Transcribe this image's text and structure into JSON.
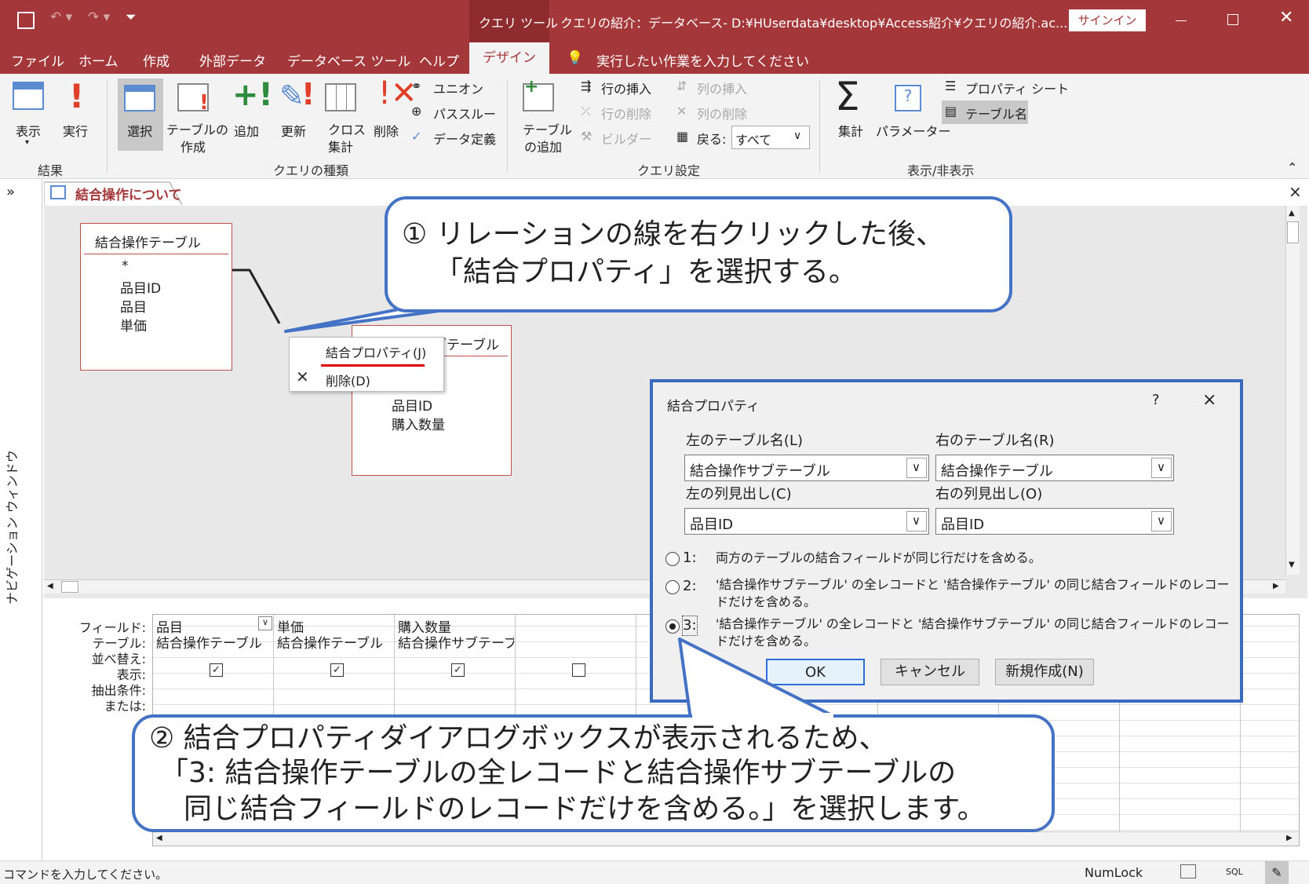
{
  "title_bar": {
    "context_tool_label": "クエリ ツール",
    "title": "クエリの紹介：データベース- D:¥HUserdata¥desktop¥Access紹介¥クエリの紹介.ac...",
    "signin": "サインイン"
  },
  "menu": {
    "tabs": [
      "ファイル",
      "ホーム",
      "作成",
      "外部データ",
      "データベース ツール",
      "ヘルプ"
    ],
    "active_tab": "デザイン",
    "tell_me": "実行したい作業を入力してください"
  },
  "ribbon": {
    "results": {
      "view": "表示",
      "run": "実行",
      "group": "結果"
    },
    "query_type": {
      "select": "選択",
      "make_table_1": "テーブルの",
      "make_table_2": "作成",
      "append": "追加",
      "update": "更新",
      "crosstab_1": "クロス",
      "crosstab_2": "集計",
      "delete": "削除",
      "union": "ユニオン",
      "passthrough": "パススルー",
      "data_definition": "データ定義",
      "group": "クエリの種類"
    },
    "query_setup": {
      "add_table_1": "テーブル",
      "add_table_2": "の追加",
      "insert_rows": "行の挿入",
      "delete_rows": "行の削除",
      "builder": "ビルダー",
      "insert_columns": "列の挿入",
      "delete_columns": "列の削除",
      "return_label": "戻る:",
      "return_value": "すべて",
      "group": "クエリ設定"
    },
    "show_hide": {
      "totals": "集計",
      "parameters": "パラメーター",
      "property_sheet": "プロパティ シート",
      "table_names": "テーブル名",
      "group": "表示/非表示"
    }
  },
  "nav_pane": {
    "label": "ナビゲーション ウィンドウ",
    "expand": "»"
  },
  "document": {
    "tab_title": "結合操作について",
    "close": "×"
  },
  "tables": {
    "left": {
      "name": "結合操作テーブル",
      "fields": [
        "*",
        "品目ID",
        "品目",
        "単価"
      ]
    },
    "right": {
      "name": "結合操作サブテーブル",
      "fields": [
        "品目ID",
        "購入数量"
      ]
    }
  },
  "context_menu": {
    "join_properties": "結合プロパティ(J)",
    "delete": "削除(D)"
  },
  "dialog": {
    "title": "結合プロパティ",
    "help": "?",
    "close": "×",
    "left_table_label": "左のテーブル名(L)",
    "left_table_value": "結合操作サブテーブル",
    "right_table_label": "右のテーブル名(R)",
    "right_table_value": "結合操作テーブル",
    "left_column_label": "左の列見出し(C)",
    "left_column_value": "品目ID",
    "right_column_label": "右の列見出し(O)",
    "right_column_value": "品目ID",
    "option1_num": "1:",
    "option1": "両方のテーブルの結合フィールドが同じ行だけを含める。",
    "option2_num": "2:",
    "option2_a": "'結合操作サブテーブル' の全レコードと '結合操作テーブル' の同じ結合フィールドのレコー",
    "option2_b": "ドだけを含める。",
    "option3_num": "3:",
    "option3_a": "'結合操作テーブル' の全レコードと '結合操作サブテーブル' の同じ結合フィールドのレコー",
    "option3_b": "ドだけを含める。",
    "ok": "OK",
    "cancel": "キャンセル",
    "new": "新規作成(N)"
  },
  "callouts": {
    "first_1": "① リレーションの線を右クリックした後、",
    "first_2": "「結合プロパティ」を選択する。",
    "second_1": "② 結合プロパティダイアログボックスが表示されるため、",
    "second_2": "「3: 結合操作テーブルの全レコードと結合操作サブテーブルの",
    "second_3": "同じ結合フィールドのレコードだけを含める。」を選択します。"
  },
  "qbe": {
    "row_labels": [
      "フィールド:",
      "テーブル:",
      "並べ替え:",
      "表示:",
      "抽出条件:",
      "または:"
    ],
    "columns": [
      {
        "field": "品目",
        "table": "結合操作テーブル",
        "show": true
      },
      {
        "field": "単価",
        "table": "結合操作テーブル",
        "show": true
      },
      {
        "field": "購入数量",
        "table": "結合操作サブテーブル",
        "show": true
      },
      {
        "field": "",
        "table": "",
        "show": false
      }
    ]
  },
  "status": {
    "left": "コマンドを入力してください。",
    "numlock": "NumLock",
    "sql": "SQL"
  }
}
